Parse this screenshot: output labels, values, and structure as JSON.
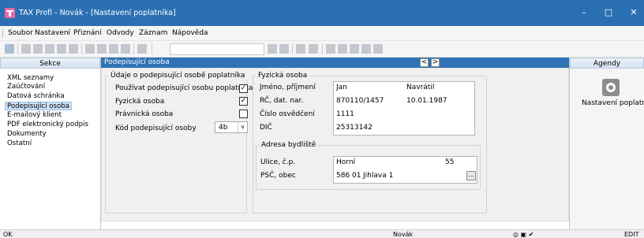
{
  "window": {
    "title": "TAX Profi - Novák - [Nastavení poplatníka]",
    "controls": {
      "minimize": "–",
      "maximize": "□",
      "close": "✕"
    }
  },
  "menu": [
    "Soubor",
    "Nastavení",
    "Přiznání",
    "Odvody",
    "Záznam",
    "Nápověda"
  ],
  "sekce": {
    "header": "Sekce",
    "items": [
      "XML seznamy",
      "Zaúčtování",
      "Datová schránka",
      "Podepisující osoba",
      "E-mailový klient",
      "PDF elektronický podpis",
      "Dokumenty",
      "Ostatní"
    ],
    "selected_index": 3
  },
  "panel": {
    "title": "Podepisující osoba",
    "prev": "<",
    "next": ">",
    "udaje": {
      "title": "Údaje o podepisující osobě poplatníka",
      "checks": [
        {
          "label": "Používat podepisující osobu poplatníka",
          "checked": true,
          "mark": "✓"
        },
        {
          "label": "Fyzická osoba",
          "checked": true,
          "mark": "✓"
        },
        {
          "label": "Právnická osoba",
          "checked": false,
          "mark": ""
        }
      ],
      "kod_label": "Kód podepisující osoby",
      "kod_value": "4b",
      "kod_arrow": "∨"
    },
    "fyzicka": {
      "title": "Fyzická osoba",
      "jmeno_label": "Jméno, příjmení",
      "jmeno": "Jan",
      "prijmeni": "Navrátil",
      "rc_label": "RČ, dat. nar.",
      "rc": "870110/1457",
      "dat_nar": "10.01.1987",
      "osvedceni_label": "Číslo osvědčení",
      "osvedceni": "1111",
      "dic_label": "DIČ",
      "dic": "25313142"
    },
    "adresa": {
      "title": "Adresa bydliště",
      "ulice_label": "Ulice, č.p.",
      "ulice": "Horní",
      "cp": "55",
      "psc_label": "PSČ, obec",
      "psc": "586 01",
      "obec": "Jihlava 1",
      "more": "…"
    }
  },
  "agendy": {
    "header": "Agendy",
    "item": "Nastavení poplatníka"
  },
  "status": {
    "left": "OK",
    "user": "Novák",
    "right": "EDIT"
  },
  "colors": {
    "titlebar": "#2b70b3",
    "panel_header": "#2f73b6",
    "selection": "#cde1f6"
  }
}
